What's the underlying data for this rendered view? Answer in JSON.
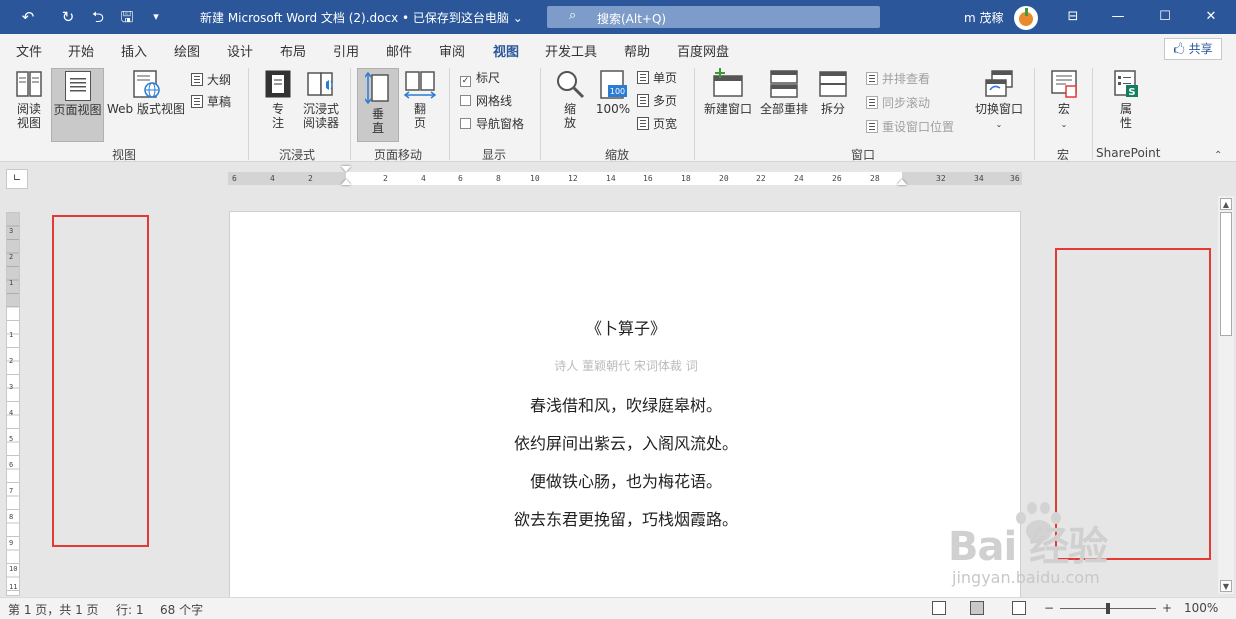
{
  "titlebar": {
    "title": "新建 Microsoft Word 文档 (2).docx • 已保存到这台电脑 ⌄",
    "search_placeholder": "搜索(Alt+Q)",
    "user_name": "m 茂稼",
    "undo_glyph": "↶",
    "redo_glyph": "↻",
    "touch_glyph": "⮌",
    "save_glyph": "🖫",
    "customize_glyph": "▾",
    "ribbon_display_glyph": "⊟",
    "minimize_glyph": "—",
    "maximize_glyph": "☐",
    "close_glyph": "✕"
  },
  "menu": {
    "tabs": [
      "文件",
      "开始",
      "插入",
      "绘图",
      "设计",
      "布局",
      "引用",
      "邮件",
      "审阅",
      "视图",
      "开发工具",
      "帮助",
      "百度网盘"
    ],
    "active_tab": "视图",
    "share_label": "🖒 共享"
  },
  "ribbon": {
    "groups": {
      "view": "视图",
      "immersive": "沉浸式",
      "page_move": "页面移动",
      "show": "显示",
      "zoom": "缩放",
      "window": "窗口",
      "macro": "宏",
      "sharepoint": "SharePoint"
    },
    "buttons": {
      "read_mode_1": "阅读",
      "read_mode_2": "视图",
      "print_layout": "页面视图",
      "web_layout": "Web 版式视图",
      "outline": "大纲",
      "draft": "草稿",
      "focus_1": "专",
      "focus_2": "注",
      "immersive_reader_1": "沉浸式",
      "immersive_reader_2": "阅读器",
      "vertical_1": "垂",
      "vertical_2": "直",
      "side_to_side_1": "翻",
      "side_to_side_2": "页",
      "ruler": "标尺",
      "gridlines": "网格线",
      "nav_pane": "导航窗格",
      "zoom_1": "缩",
      "zoom_2": "放",
      "zoom_100": "100%",
      "one_page": "单页",
      "multiple_pages": "多页",
      "page_width": "页宽",
      "new_window": "新建窗口",
      "arrange_all": "全部重排",
      "split": "拆分",
      "side_by_side": "并排查看",
      "sync_scroll": "同步滚动",
      "reset_window": "重设窗口位置",
      "switch_windows": "切换窗口",
      "macros": "宏",
      "properties_1": "属",
      "properties_2": "性"
    },
    "checks": {
      "ruler": "✓",
      "gridlines": "",
      "nav_pane": ""
    },
    "active_view": "print_layout",
    "active_page_move": "vertical"
  },
  "ruler": {
    "tab_selector": "∟",
    "h_labels": [
      "6",
      "4",
      "2",
      "2",
      "4",
      "6",
      "8",
      "10",
      "12",
      "14",
      "16",
      "18",
      "20",
      "22",
      "24",
      "26",
      "28",
      "32",
      "34",
      "36"
    ],
    "v_labels": [
      "3",
      "2",
      "1",
      "1",
      "2",
      "3",
      "4",
      "5",
      "6",
      "7",
      "8",
      "9",
      "10",
      "11"
    ]
  },
  "document": {
    "title": "《卜算子》",
    "author": "诗人 董颖朝代 宋词体裁 词",
    "lines": [
      "春浅借和风，吹绿庭皋树。",
      "依约屏间出紫云，入阁风流处。",
      "便做铁心肠，也为梅花语。",
      "欲去东君更挽留，巧栈烟霞路。"
    ]
  },
  "watermark": {
    "brand": "Bai  经验",
    "sub": "jingyan.baidu.com"
  },
  "statusbar": {
    "page": "第 1 页，共 1 页",
    "line": "行: 1",
    "words": "68 个字",
    "zoom_minus": "−",
    "zoom_plus": "+",
    "zoom": "100%"
  },
  "colors": {
    "titlebar": "#2b579a",
    "highlight": "#e53935"
  }
}
